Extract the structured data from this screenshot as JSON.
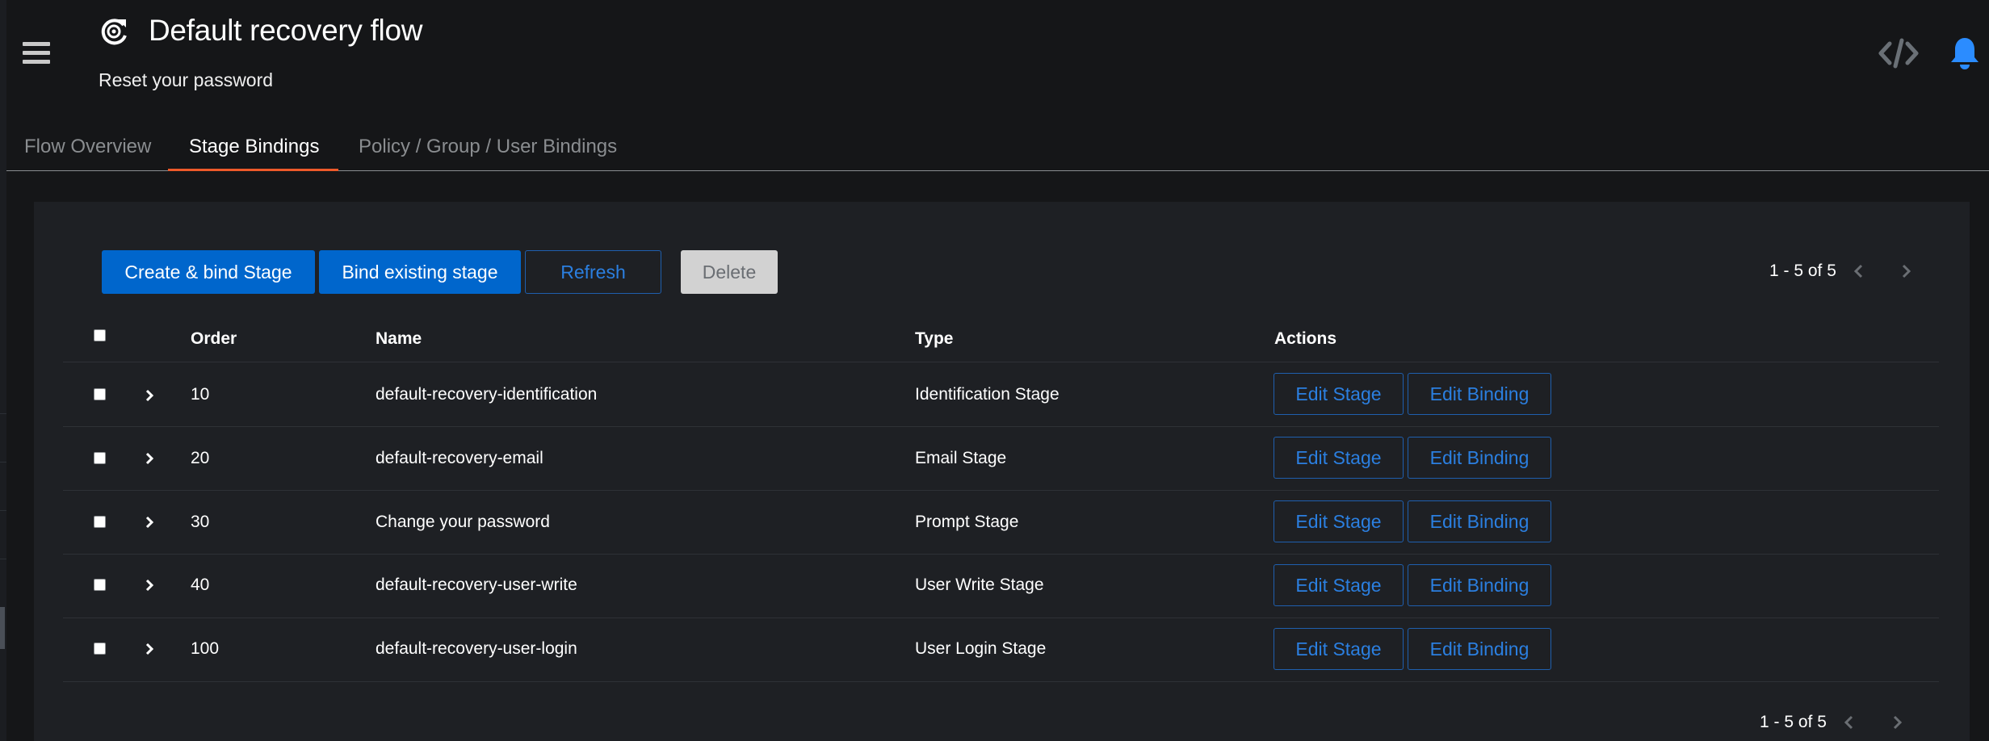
{
  "header": {
    "title": "Default recovery flow",
    "subtitle": "Reset your password",
    "icons": {
      "menu": "hamburger-icon",
      "flow": "flow-recovery-icon",
      "code": "code-icon",
      "notifications": "bell-icon"
    },
    "accent_color": "#0066cc",
    "notification_color": "#2b8cff"
  },
  "tabs": [
    {
      "label": "Flow Overview",
      "active": false
    },
    {
      "label": "Stage Bindings",
      "active": true
    },
    {
      "label": "Policy / Group / User Bindings",
      "active": false
    }
  ],
  "toolbar": {
    "create_label": "Create & bind Stage",
    "bind_label": "Bind existing stage",
    "refresh_label": "Refresh",
    "delete_label": "Delete"
  },
  "pagination": {
    "top_text": "1 - 5 of 5",
    "bottom_text": "1 - 5 of 5"
  },
  "table": {
    "columns": [
      "Order",
      "Name",
      "Type",
      "Actions"
    ],
    "rows": [
      {
        "order": "10",
        "name": "default-recovery-identification",
        "type": "Identification Stage",
        "edit_stage": "Edit Stage",
        "edit_binding": "Edit Binding"
      },
      {
        "order": "20",
        "name": "default-recovery-email",
        "type": "Email Stage",
        "edit_stage": "Edit Stage",
        "edit_binding": "Edit Binding"
      },
      {
        "order": "30",
        "name": "Change your password",
        "type": "Prompt Stage",
        "edit_stage": "Edit Stage",
        "edit_binding": "Edit Binding"
      },
      {
        "order": "40",
        "name": "default-recovery-user-write",
        "type": "User Write Stage",
        "edit_stage": "Edit Stage",
        "edit_binding": "Edit Binding"
      },
      {
        "order": "100",
        "name": "default-recovery-user-login",
        "type": "User Login Stage",
        "edit_stage": "Edit Stage",
        "edit_binding": "Edit Binding"
      }
    ]
  }
}
